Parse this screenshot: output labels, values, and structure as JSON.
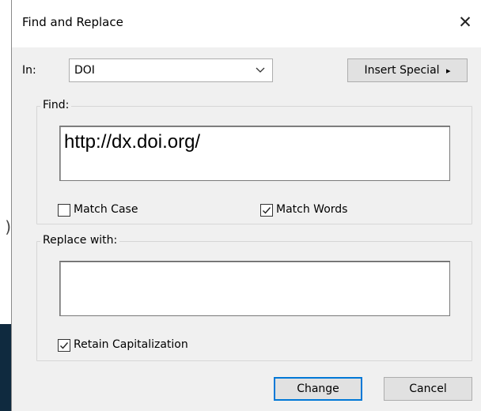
{
  "background": {
    "fragment_text": ")"
  },
  "dialog": {
    "title": "Find and Replace",
    "close_icon": "✕"
  },
  "in_field": {
    "label": "In:",
    "value": "DOI"
  },
  "insert_special": {
    "label": "Insert Special",
    "arrow": "▸"
  },
  "find_group": {
    "legend": "Find:",
    "value": "http://dx.doi.org/",
    "match_case": {
      "label": "Match Case",
      "checked": false
    },
    "match_words": {
      "label": "Match Words",
      "checked": true
    }
  },
  "replace_group": {
    "legend": "Replace with:",
    "value": "",
    "retain_capitalization": {
      "label": "Retain Capitalization",
      "checked": true
    }
  },
  "buttons": {
    "change": "Change",
    "cancel": "Cancel"
  },
  "colors": {
    "dialog_bg": "#f0f0f0",
    "button_bg": "#e1e1e1",
    "default_button_border": "#0078d7",
    "background_dark": "#0f2a3f"
  }
}
